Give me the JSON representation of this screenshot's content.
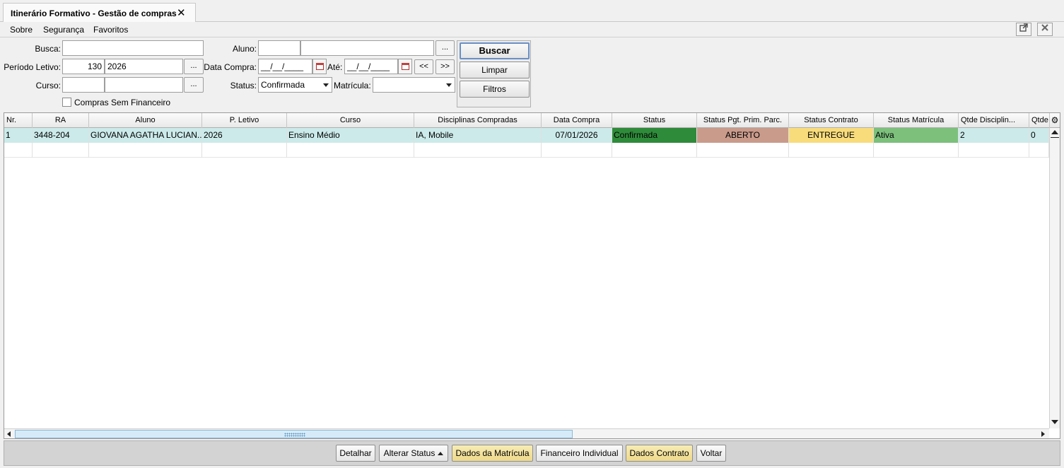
{
  "tab": {
    "title": "Itinerário Formativo - Gestão de compras",
    "close": "✕"
  },
  "menu": {
    "items": [
      "Sobre",
      "Segurança",
      "Favoritos"
    ]
  },
  "window": {
    "detach_icon": "external-window-icon",
    "close_icon": "close-icon"
  },
  "filters": {
    "busca_label": "Busca:",
    "busca_value": "",
    "periodo_label": "Período Letivo:",
    "periodo_code": "130",
    "periodo_year": "2026",
    "curso_label": "Curso:",
    "curso_code": "",
    "curso_name": "",
    "lookup_label": "...",
    "aluno_label": "Aluno:",
    "aluno_code": "",
    "aluno_name": "",
    "data_compra_label": "Data Compra:",
    "data_compra_value": "__/__/____",
    "ate_label": "Até:",
    "ate_value": "__/__/____",
    "prev_label": "<<",
    "next_label": ">>",
    "status_label": "Status:",
    "status_value": "Confirmada",
    "matricula_label": "Matrícula:",
    "matricula_value": "",
    "sem_financeiro_label": "Compras Sem Financeiro"
  },
  "actions": {
    "buscar": "Buscar",
    "limpar": "Limpar",
    "filtros": "Filtros"
  },
  "grid": {
    "columns": [
      "Nr.",
      "RA",
      "Aluno",
      "P. Letivo",
      "Curso",
      "Disciplinas Compradas",
      "Data Compra",
      "Status",
      "Status Pgt. Prim. Parc.",
      "Status Contrato",
      "Status Matrícula",
      "Qtde Disciplin...",
      "Qtde"
    ],
    "rows": [
      [
        "1",
        "3448-204",
        "GIOVANA AGATHA LUCIAN...",
        "2026",
        "Ensino Médio",
        "IA, Mobile",
        "07/01/2026",
        "Confirmada",
        "ABERTO",
        "ENTREGUE",
        "Ativa",
        "2",
        "0"
      ]
    ],
    "status_colors": {
      "confirmada": "#2e8b3a",
      "aberto": "#c99b8b",
      "entregue": "#f8dc7c",
      "ativa": "#7cc07c",
      "selected_row": "#cceaea"
    }
  },
  "footer": {
    "detalhar": "Detalhar",
    "alterar_status": "Alterar Status",
    "dados_matricula": "Dados da Matrícula",
    "financeiro_individual": "Financeiro Individual",
    "dados_contrato": "Dados Contrato",
    "voltar": "Voltar"
  }
}
